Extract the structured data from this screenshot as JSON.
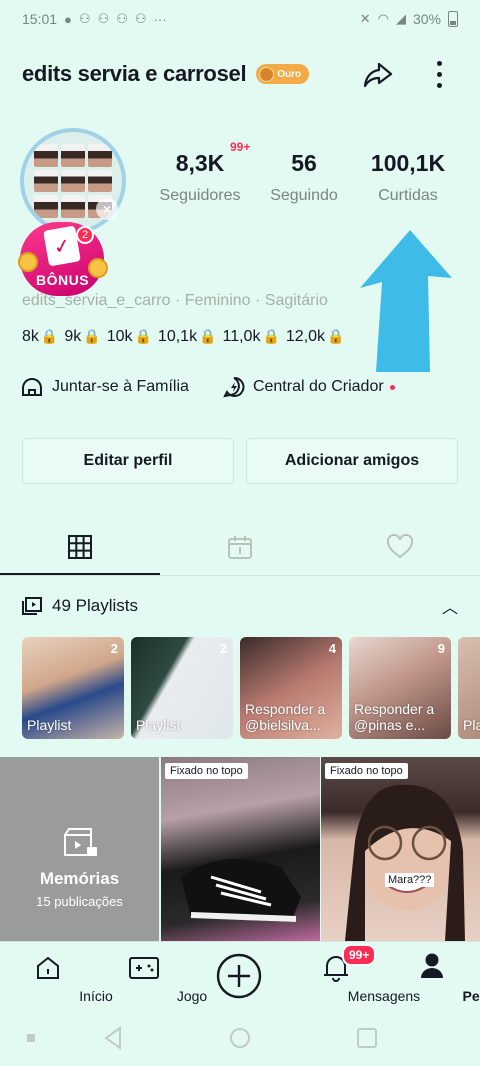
{
  "status_bar": {
    "time": "15:01",
    "battery": "30%"
  },
  "header": {
    "username": "edits servia e carrosel",
    "badge": "Ouro"
  },
  "stats": [
    {
      "value": "8,3K",
      "label": "Seguidores",
      "badge": "99+"
    },
    {
      "value": "56",
      "label": "Seguindo"
    },
    {
      "value": "100,1K",
      "label": "Curtidas"
    }
  ],
  "bonus": {
    "label": "BÔNUS",
    "count": "2"
  },
  "bio": {
    "line": "edits_servia_e_carro · Feminino · Sagitário"
  },
  "milestones": [
    "8k",
    "9k",
    "10k",
    "10,1k",
    "11,0k",
    "12,0k"
  ],
  "links": {
    "family": "Juntar-se à Família",
    "creator": "Central do Criador"
  },
  "buttons": {
    "edit": "Editar perfil",
    "add": "Adicionar amigos"
  },
  "playlists": {
    "header": "49 Playlists",
    "items": [
      {
        "count": "2",
        "title": "Playlist"
      },
      {
        "count": "2",
        "title": "Playlist"
      },
      {
        "count": "4",
        "title": "Responder a @bielsilva..."
      },
      {
        "count": "9",
        "title": "Responder a @pinas e..."
      },
      {
        "count": "",
        "title": "Pla"
      }
    ]
  },
  "grid": {
    "memories_title": "Memórias",
    "memories_sub": "15 publicações",
    "pinned_label": "Fixado no topo",
    "caption": "Mara???"
  },
  "nav": {
    "home": "Início",
    "game": "Jogo",
    "messages": "Mensagens",
    "messages_badge": "99+",
    "profile": "Perfil"
  },
  "colors": {
    "accent": "#fe2c55",
    "bg": "#e2faf2",
    "arrow": "#2eb4e6",
    "gold": "#f2ab45"
  }
}
